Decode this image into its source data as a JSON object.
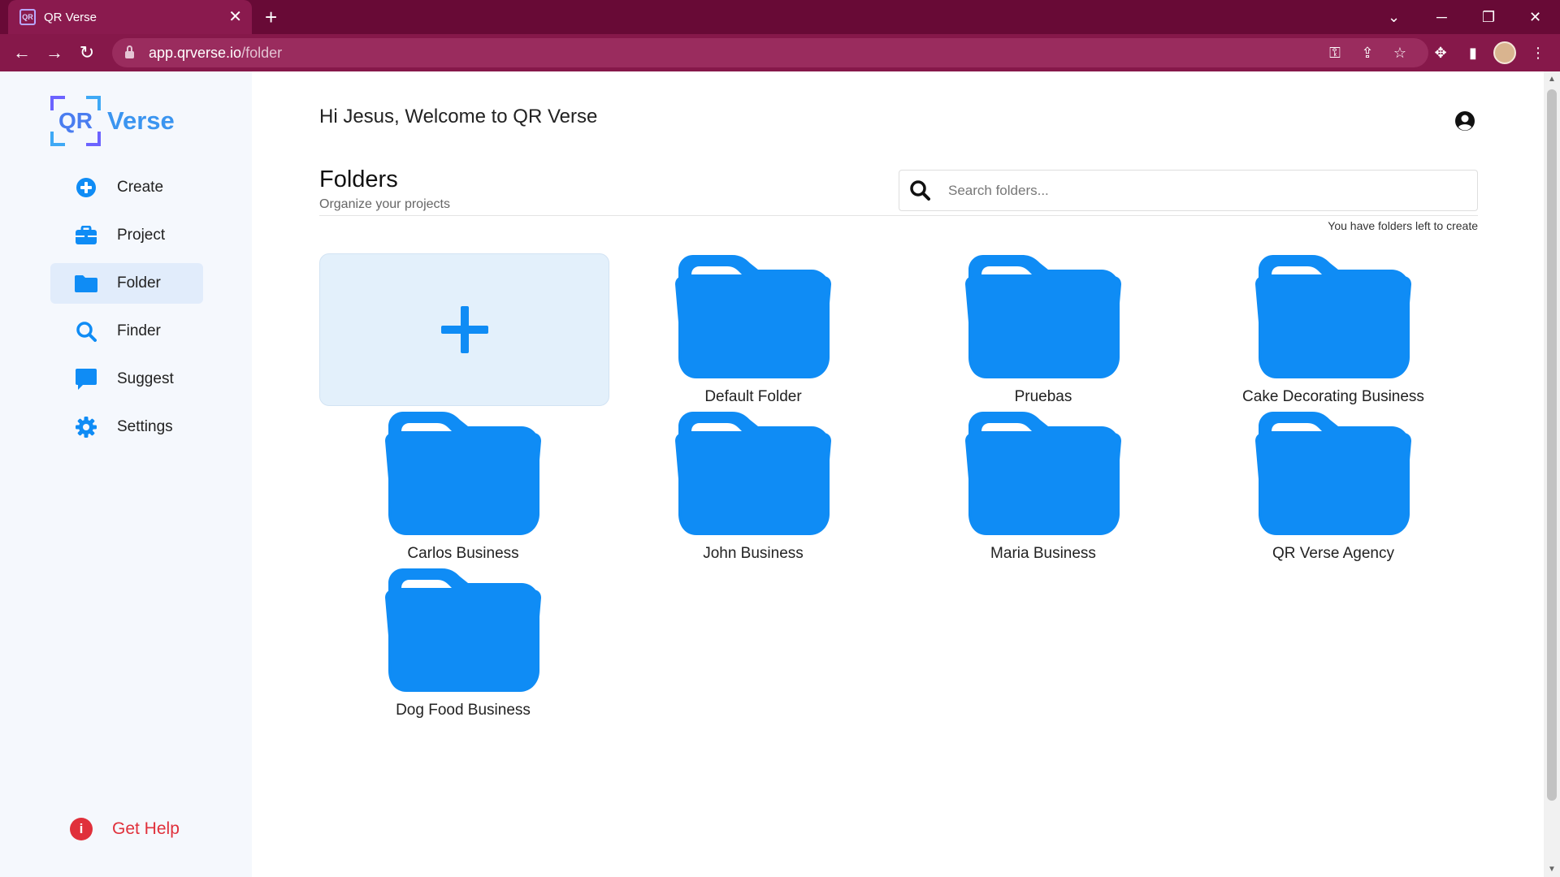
{
  "browser": {
    "tab_title": "QR Verse",
    "tab_favicon_text": "QR",
    "url_host": "app.qrverse.io",
    "url_path": "/folder",
    "accent": "#680a36"
  },
  "sidebar": {
    "logo_mark": "QR",
    "logo_word": "Verse",
    "items": [
      {
        "label": "Create",
        "icon": "plus-circle-icon"
      },
      {
        "label": "Project",
        "icon": "briefcase-icon"
      },
      {
        "label": "Folder",
        "icon": "folder-icon",
        "active": true
      },
      {
        "label": "Finder",
        "icon": "search-icon"
      },
      {
        "label": "Suggest",
        "icon": "chat-bubble-icon"
      },
      {
        "label": "Settings",
        "icon": "gear-icon"
      }
    ],
    "help_label": "Get Help",
    "help_icon_text": "i"
  },
  "main": {
    "greeting": "Hi Jesus, Welcome to QR Verse",
    "title": "Folders",
    "subtitle": "Organize your projects",
    "search_placeholder": "Search folders...",
    "quota_text": "You have folders left to create",
    "folder_color": "#0f8cf5",
    "folders": [
      "Default Folder",
      "Pruebas",
      "Cake Decorating Business",
      "Carlos Business",
      "John Business",
      "Maria Business",
      "QR Verse Agency",
      "Dog Food Business"
    ]
  }
}
